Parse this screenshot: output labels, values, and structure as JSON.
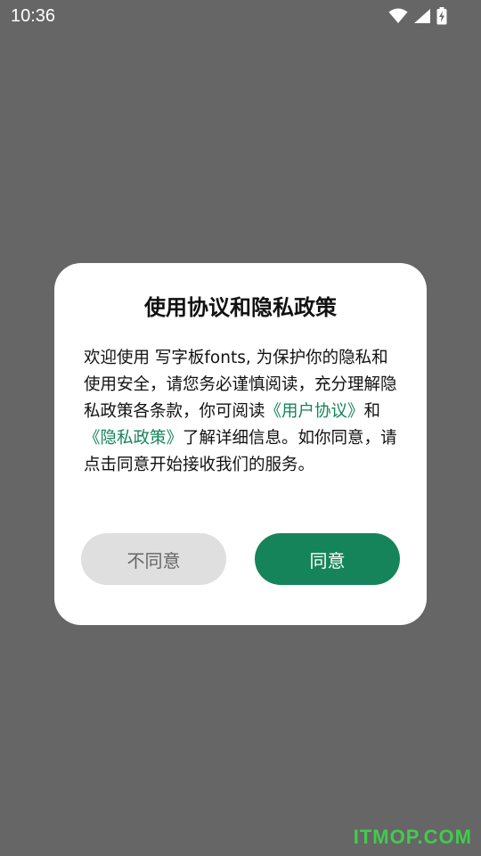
{
  "status_bar": {
    "time": "10:36",
    "icons": [
      "wifi-icon",
      "signal-icon",
      "battery-charging-icon"
    ]
  },
  "dialog": {
    "title": "使用协议和隐私政策",
    "body": {
      "part1": "欢迎使用 写字板fonts, 为保护你的隐私和使用安全，请您务必谨慎阅读，充分理解隐私政策各条款，你可阅读",
      "link_user_agreement": "《用户协议》",
      "part2": "和",
      "link_privacy_policy": "《隐私政策》",
      "part3": "了解详细信息。如你同意，请点击同意开始接收我们的服务。"
    },
    "decline_label": "不同意",
    "agree_label": "同意"
  },
  "watermark": "ITMOP.COM",
  "colors": {
    "overlay": "#666666",
    "accent": "#15845a",
    "decline_bg": "#dfdfdf",
    "watermark": "#3fd64b"
  }
}
